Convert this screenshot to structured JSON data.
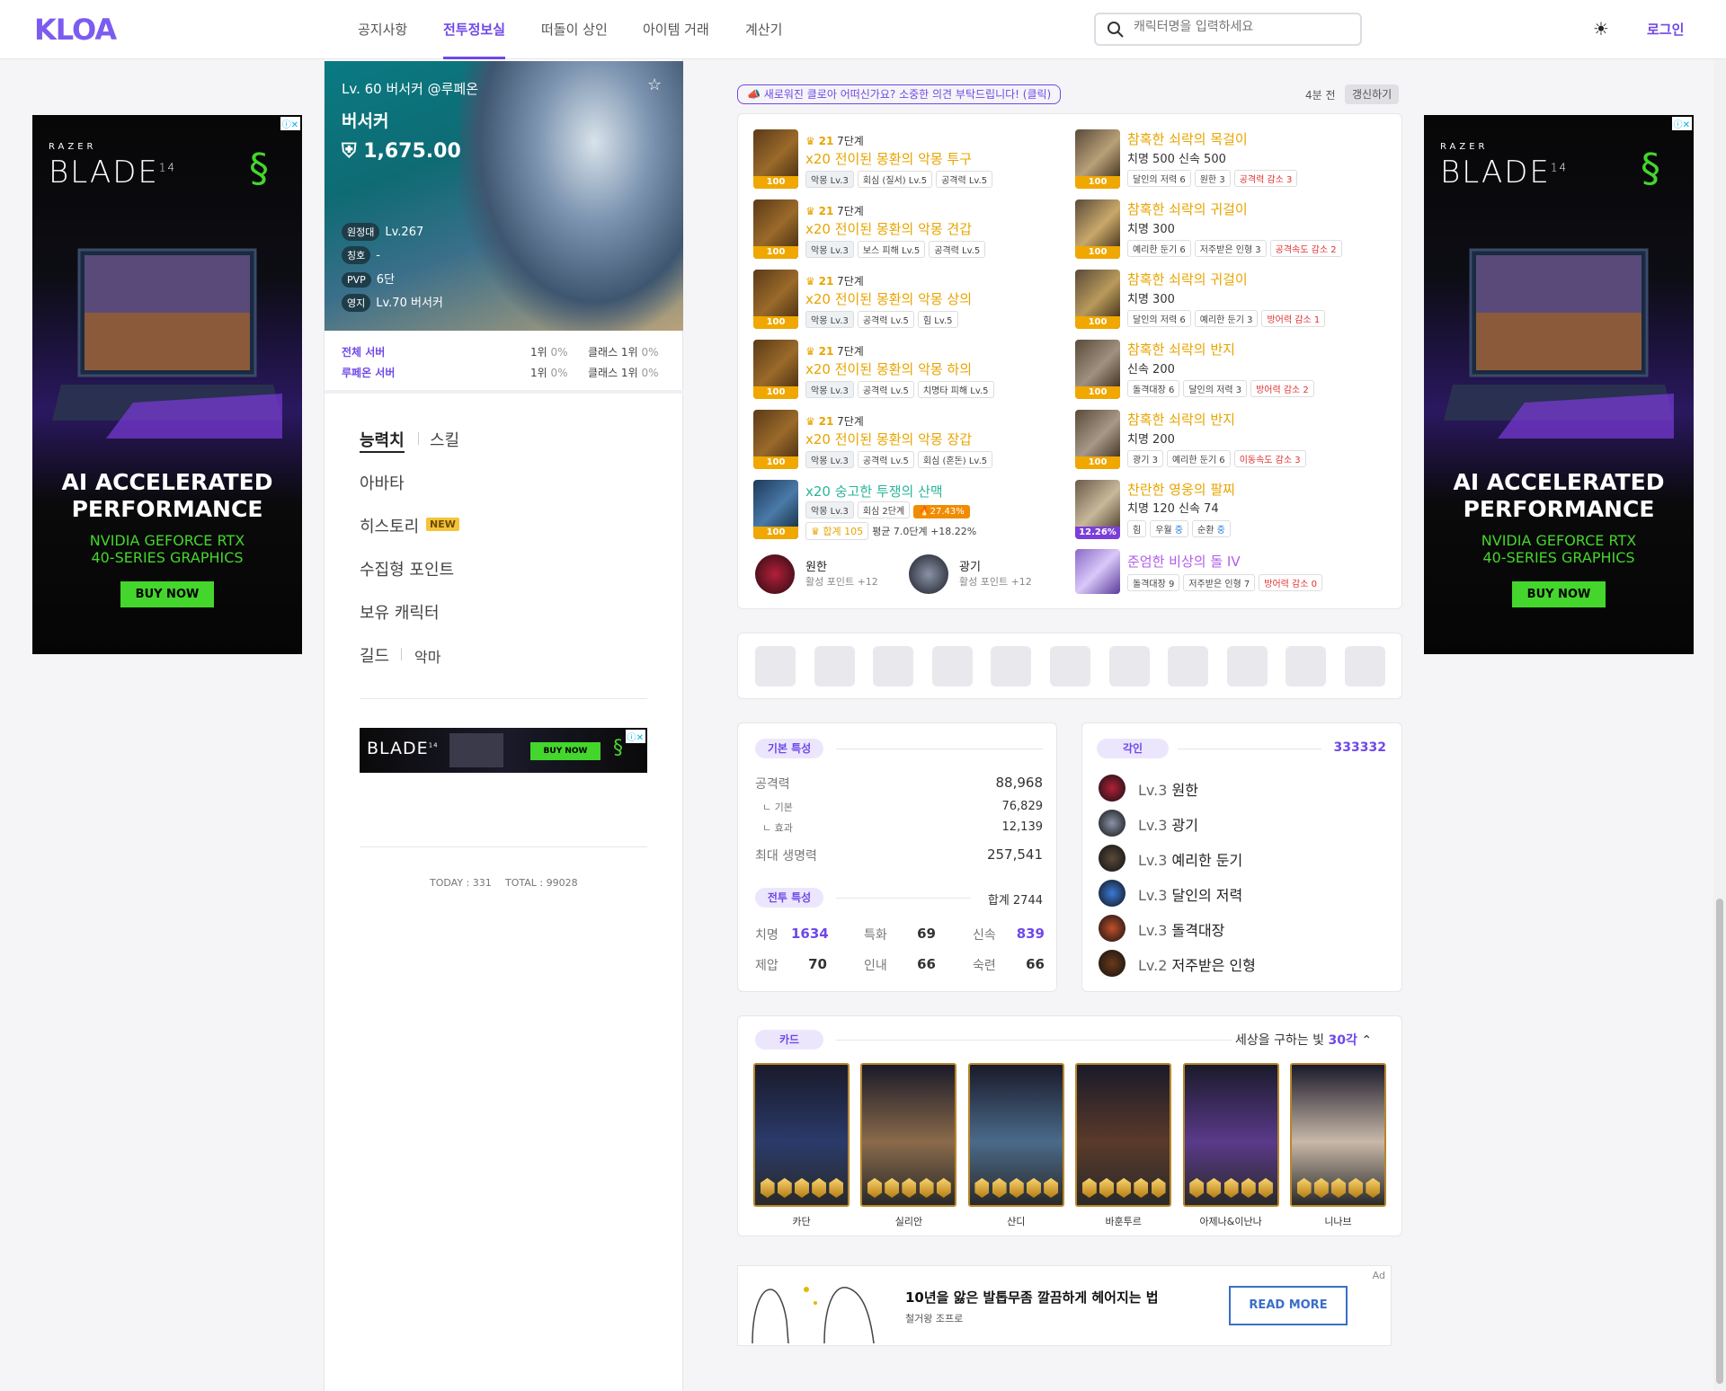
{
  "header": {
    "logo": "KLOA",
    "nav": [
      "공지사항",
      "전투정보실",
      "떠돌이 상인",
      "아이템 거래",
      "계산기"
    ],
    "active_nav": "전투정보실",
    "search_placeholder": "캐릭터명을 입력하세요",
    "login": "로그인"
  },
  "ad_razer": {
    "brand": "RAZER",
    "title": "BLADE",
    "model": "14",
    "headline1": "AI ACCELERATED",
    "headline2": "PERFORMANCE",
    "sub1": "NVIDIA GEFORCE RTX",
    "sub2": "40-SERIES GRAPHICS",
    "cta": "BUY NOW"
  },
  "profile": {
    "header": "Lv. 60 버서커 @루페온",
    "class": "버서커",
    "item_level": "1,675.00",
    "tags": [
      {
        "label": "원정대",
        "value": "Lv.267"
      },
      {
        "label": "칭호",
        "value": "-"
      },
      {
        "label": "PVP",
        "value": "6단"
      },
      {
        "label": "영지",
        "value": "Lv.70 버서커"
      }
    ],
    "ranks": [
      {
        "scope": "전체 서버",
        "rank": "1위",
        "pct": "0%",
        "class_rank": "클래스 1위",
        "class_pct": "0%"
      },
      {
        "scope": "루페온 서버",
        "rank": "1위",
        "pct": "0%",
        "class_rank": "클래스 1위",
        "class_pct": "0%"
      }
    ]
  },
  "left_menu": {
    "tab1": "능력치",
    "tab2": "스킬",
    "avatar": "아바타",
    "history": "히스토리",
    "new_badge": "NEW",
    "collect": "수집형 포인트",
    "chars": "보유 캐릭터",
    "guild": "길드",
    "demon": "악마",
    "ad_cta": "BUY NOW",
    "today": "TODAY : 331",
    "total": "TOTAL : 99028"
  },
  "feedback": {
    "banner": "새로워진 클로아 어떠신가요? 소중한 의견 부탁드립니다! (클릭)",
    "time": "4분 전",
    "refresh": "갱신하기"
  },
  "equipment": [
    {
      "step_star": "21",
      "step": "7단계",
      "name": "x20 전이된 몽환의 악몽 투구",
      "quality": "100",
      "chips": [
        "악몽 Lv.3",
        "회심 (질서) Lv.5",
        "공격력 Lv.5"
      ]
    },
    {
      "step_star": "21",
      "step": "7단계",
      "name": "x20 전이된 몽환의 악몽 견갑",
      "quality": "100",
      "chips": [
        "악몽 Lv.3",
        "보스 피해 Lv.5",
        "공격력 Lv.5"
      ]
    },
    {
      "step_star": "21",
      "step": "7단계",
      "name": "x20 전이된 몽환의 악몽 상의",
      "quality": "100",
      "chips": [
        "악몽 Lv.3",
        "공격력 Lv.5",
        "힘 Lv.5"
      ]
    },
    {
      "step_star": "21",
      "step": "7단계",
      "name": "x20 전이된 몽환의 악몽 하의",
      "quality": "100",
      "chips": [
        "악몽 Lv.3",
        "공격력 Lv.5",
        "치명타 피해 Lv.5"
      ]
    },
    {
      "step_star": "21",
      "step": "7단계",
      "name": "x20 전이된 몽환의 악몽 장갑",
      "quality": "100",
      "chips": [
        "악몽 Lv.3",
        "공격력 Lv.5",
        "회심 (혼돈) Lv.5"
      ]
    }
  ],
  "weapon": {
    "name": "x20 숭고한 투쟁의 산맥",
    "quality": "100",
    "chips": [
      "악몽 Lv.3",
      "회심 2단계",
      "27.43%"
    ],
    "total": "합계 105",
    "avg": "평균 7.0단계 +18.22%"
  },
  "gems_small": [
    {
      "name": "원한",
      "sub": "활성 포인트 +12"
    },
    {
      "name": "광기",
      "sub": "활성 포인트 +12"
    }
  ],
  "accessories": [
    {
      "name": "참혹한 쇠락의 목걸이",
      "stat": "치명 500 신속 500",
      "quality": "100",
      "chips": [
        "달인의 저력 6",
        "원한 3",
        "공격력 감소 3"
      ]
    },
    {
      "name": "참혹한 쇠락의 귀걸이",
      "stat": "치명 300",
      "quality": "100",
      "chips": [
        "예리한 둔기 6",
        "저주받은 인형 3",
        "공격속도 감소 2"
      ]
    },
    {
      "name": "참혹한 쇠락의 귀걸이",
      "stat": "치명 300",
      "quality": "100",
      "chips": [
        "달인의 저력 6",
        "예리한 둔기 3",
        "방어력 감소 1"
      ]
    },
    {
      "name": "참혹한 쇠락의 반지",
      "stat": "신속 200",
      "quality": "100",
      "chips": [
        "돌격대장 6",
        "달인의 저력 3",
        "방어력 감소 2"
      ]
    },
    {
      "name": "참혹한 쇠락의 반지",
      "stat": "치명 200",
      "quality": "100",
      "chips": [
        "광기 3",
        "예리한 둔기 6",
        "이동속도 감소 3"
      ]
    }
  ],
  "bracelet": {
    "name": "찬란한 영웅의 팔찌",
    "stat": "치명 120 신속 74",
    "quality": "12.26%",
    "chips": [
      "힘",
      "우월",
      "중",
      "순환",
      "중"
    ]
  },
  "stone": {
    "name": "준엄한 비상의 돌 IV",
    "chips": [
      "돌격대장 9",
      "저주받은 인형 7",
      "방어력 감소 0"
    ]
  },
  "basic_stats": {
    "tag": "기본 특성",
    "attack_label": "공격력",
    "attack": "88,968",
    "base_label": "ㄴ 기본",
    "base": "76,829",
    "effect_label": "ㄴ 효과",
    "effect": "12,139",
    "hp_label": "최대 생명력",
    "hp": "257,541",
    "combat_tag": "전투 특성",
    "combat_total": "합계 2744",
    "combat": [
      {
        "label": "치명",
        "value": "1634"
      },
      {
        "label": "특화",
        "value": "69"
      },
      {
        "label": "신속",
        "value": "839"
      },
      {
        "label": "제압",
        "value": "70"
      },
      {
        "label": "인내",
        "value": "66"
      },
      {
        "label": "숙련",
        "value": "66"
      }
    ]
  },
  "engravings": {
    "tag": "각인",
    "code": "333332",
    "items": [
      {
        "lv": "Lv.3",
        "name": "원한"
      },
      {
        "lv": "Lv.3",
        "name": "광기"
      },
      {
        "lv": "Lv.3",
        "name": "예리한 둔기"
      },
      {
        "lv": "Lv.3",
        "name": "달인의 저력"
      },
      {
        "lv": "Lv.3",
        "name": "돌격대장"
      },
      {
        "lv": "Lv.2",
        "name": "저주받은 인형"
      }
    ]
  },
  "cards": {
    "tag": "카드",
    "set": "세상을 구하는 빛",
    "awaken": "30각",
    "items": [
      "카단",
      "실리안",
      "샨디",
      "바훈투르",
      "아제나&이난나",
      "니나브"
    ]
  },
  "bottom_ad": {
    "title": "10년을 앓은 발톱무좀 깔끔하게 헤어지는 법",
    "sponsor": "철거왕 조프로",
    "cta": "READ MORE",
    "ad": "Ad"
  },
  "colors": {
    "accent": "#7048e8",
    "gold": "#e8a400",
    "teal": "#2bb59a",
    "red": "#e03131"
  }
}
